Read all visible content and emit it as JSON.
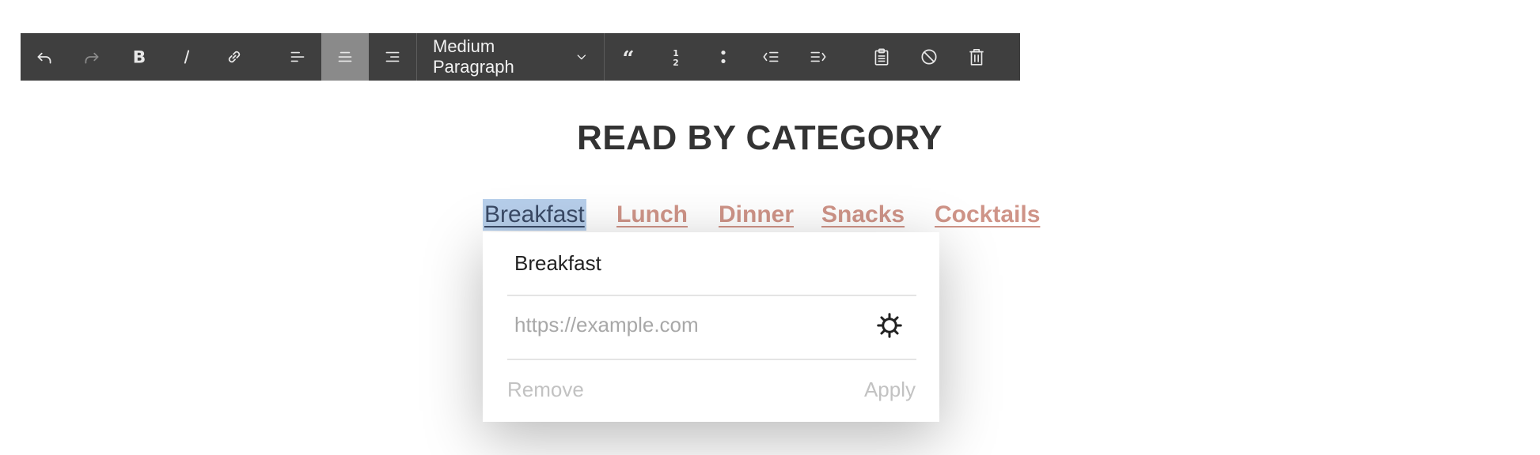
{
  "toolbar": {
    "buttons": [
      {
        "name": "undo",
        "icon": "undo-icon",
        "enabled": true
      },
      {
        "name": "redo",
        "icon": "redo-icon",
        "enabled": false
      },
      {
        "name": "bold",
        "icon": "bold-icon",
        "enabled": true
      },
      {
        "name": "italic",
        "icon": "italic-icon",
        "enabled": true
      },
      {
        "name": "link",
        "icon": "link-icon",
        "enabled": true
      },
      {
        "name": "align-left",
        "icon": "align-left-icon",
        "enabled": true
      },
      {
        "name": "align-center",
        "icon": "align-center-icon",
        "enabled": true,
        "active": true
      },
      {
        "name": "align-right",
        "icon": "align-right-icon",
        "enabled": true
      },
      {
        "name": "blockquote",
        "icon": "quote-icon",
        "enabled": true
      },
      {
        "name": "ordered-list",
        "icon": "numbered-list-icon",
        "enabled": true
      },
      {
        "name": "bullet-list",
        "icon": "bullet-list-icon",
        "enabled": true
      },
      {
        "name": "outdent",
        "icon": "outdent-icon",
        "enabled": true
      },
      {
        "name": "indent",
        "icon": "indent-icon",
        "enabled": true
      },
      {
        "name": "paste",
        "icon": "clipboard-icon",
        "enabled": true
      },
      {
        "name": "clear-format",
        "icon": "no-format-icon",
        "enabled": true
      },
      {
        "name": "delete",
        "icon": "trash-icon",
        "enabled": true
      }
    ],
    "paragraph_style": "Medium Paragraph",
    "colors": {
      "background": "#3f3f3f",
      "active": "#8a8a8a",
      "icon": "#e8e8e8",
      "icon_disabled": "#8a8a8a"
    }
  },
  "heading": "READ BY CATEGORY",
  "categories": [
    {
      "label": "Breakfast",
      "selected": true
    },
    {
      "label": "Lunch",
      "selected": false
    },
    {
      "label": "Dinner",
      "selected": false
    },
    {
      "label": "Snacks",
      "selected": false
    },
    {
      "label": "Cocktails",
      "selected": false
    }
  ],
  "link_popup": {
    "text_value": "Breakfast",
    "url_placeholder": "https://example.com",
    "url_value": "",
    "settings_icon": "gear-icon",
    "remove_label": "Remove",
    "apply_label": "Apply"
  },
  "colors": {
    "link": "#cf9488",
    "selection": "#b7cfeb",
    "heading": "#333333"
  }
}
